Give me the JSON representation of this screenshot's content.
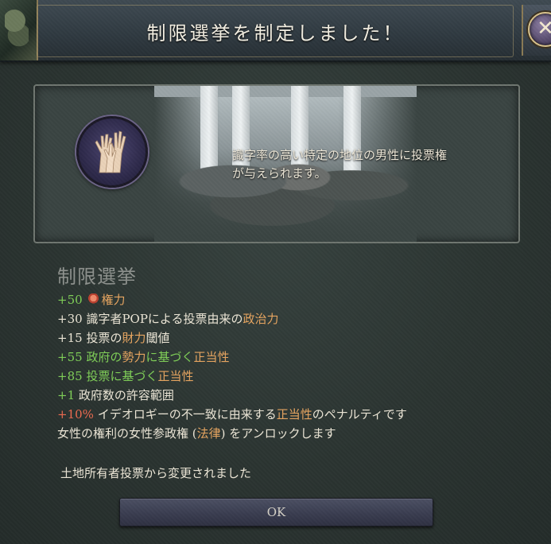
{
  "header": {
    "title": "制限選挙を制定しました！",
    "close_glyph": "✕",
    "close_icon": "close-icon"
  },
  "illustration": {
    "emblem_icon": "raised-hands-icon",
    "description_line1": "識字率の高い特定の地位の男性に投票権",
    "description_line2": "が与えられます。"
  },
  "law": {
    "name": "制限選挙"
  },
  "effects": [
    {
      "value": "+50",
      "icon": "clout-icon",
      "label": "権力"
    },
    {
      "value": "+30",
      "text": "識字者POPによる投票由来の",
      "highlight": "政治力"
    },
    {
      "value": "+15",
      "text": "投票の",
      "highlight": "財力",
      "suffix": "閾値"
    },
    {
      "value": "+55",
      "text": "政府の",
      "highlight": "勢力",
      "mid": "に基づく",
      "highlight2": "正当性"
    },
    {
      "value": "+85",
      "text": "投票に基づく",
      "highlight": "正当性"
    },
    {
      "value": "+1",
      "text": "政府数の許容範囲"
    },
    {
      "value": "+10%",
      "text": "イデオロギーの不一致に由来する",
      "highlight": "正当性",
      "suffix": "のペナルティです"
    },
    {
      "text": "女性の権利の女性参政権 (",
      "highlight": "法律",
      "suffix": ") をアンロックします"
    }
  ],
  "changed_note": "土地所有者投票から変更されました",
  "ok_button": {
    "label": "OK"
  },
  "colors": {
    "positive": "#7fcf57",
    "negative": "#ee6a4f",
    "highlight": "#e7a560",
    "text": "#ece6d6"
  }
}
